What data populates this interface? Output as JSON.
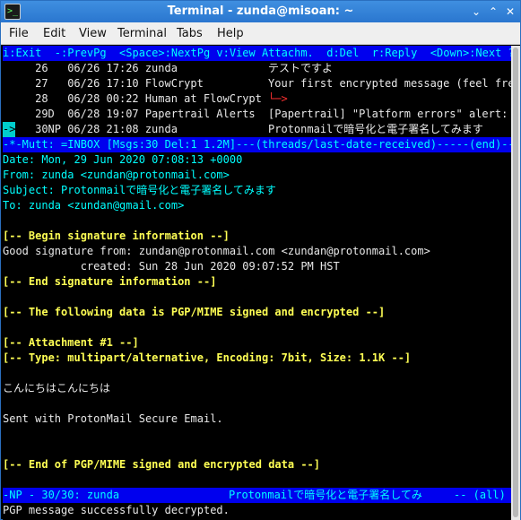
{
  "window": {
    "title": "Terminal - zunda@misoan: ~",
    "buttons": {
      "minimize": "⌄",
      "maximize": "⌃",
      "close": "✕"
    }
  },
  "menubar": [
    "File",
    "Edit",
    "View",
    "Terminal",
    "Tabs",
    "Help"
  ],
  "mutt": {
    "help_line": "i:Exit  -:PrevPg  <Space>:NextPg v:View Attachm.  d:Del  r:Reply  <Down>:Next ?:",
    "index": [
      {
        "num": "26",
        "flags": " ",
        "date": "06/26 17:26",
        "from": "zunda",
        "subject": "テストですよ"
      },
      {
        "num": "27",
        "flags": " ",
        "date": "06/26 17:10",
        "from": "FlowCrypt",
        "subject": "Your first encrypted message (feel fre"
      },
      {
        "num": "28",
        "flags": " ",
        "date": "06/28 00:22",
        "from": "Human at FlowCrypt",
        "subject": "└─>"
      },
      {
        "num": "29",
        "flags": "D",
        "date": "06/28 19:07",
        "from": "Papertrail Alerts",
        "subject": "[Papertrail] \"Platform errors\" alert:"
      },
      {
        "num": "30",
        "flags": "NP",
        "date": "06/28 21:08",
        "from": "zunda",
        "subject": "Protonmailで暗号化と電子署名してみます",
        "cursor": "->"
      }
    ],
    "index_status": "-*-Mutt: =INBOX [Msgs:30 Del:1 1.2M]---(threads/last-date-received)-----(end)----",
    "headers": {
      "date": "Date: Mon, 29 Jun 2020 07:08:13 +0000",
      "from": "From: zunda <zundan@protonmail.com>",
      "subject": "Subject: Protonmailで暗号化と電子署名してみます",
      "to": "To: zunda <zundan@gmail.com>"
    },
    "body": {
      "sig_begin": "[-- Begin signature information --]",
      "good_sig": "Good signature from: zundan@protonmail.com <zundan@protonmail.com>",
      "created": "            created: Sun 28 Jun 2020 09:07:52 PM HST",
      "sig_end": "[-- End signature information --]",
      "pgp_begin": "[-- The following data is PGP/MIME signed and encrypted --]",
      "attach": "[-- Attachment #1 --]",
      "attach_type": "[-- Type: multipart/alternative, Encoding: 7bit, Size: 1.1K --]",
      "greeting": "こんにちはこんにちは",
      "signature": "Sent with ProtonMail Secure Email.",
      "pgp_end": "[-- End of PGP/MIME signed and encrypted data --]"
    },
    "pager_status": {
      "left": "-NP - 30/30: zunda",
      "subject": "Protonmailで暗号化と電子署名してみ",
      "right": "-- (all)"
    },
    "message": "PGP message successfully decrypted."
  }
}
